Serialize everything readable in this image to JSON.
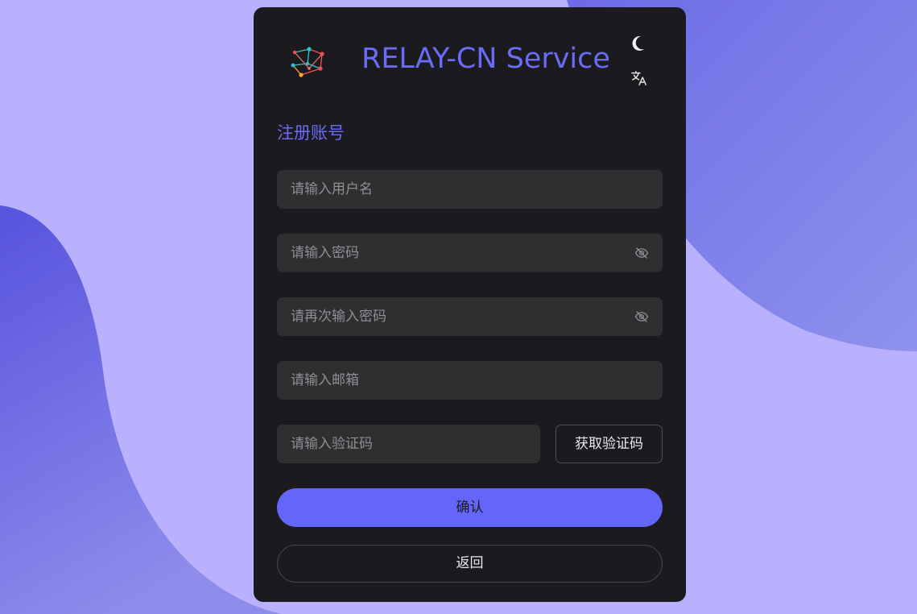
{
  "app": {
    "title": "RELAY-CN Service",
    "logo_icon": "network-graph-logo"
  },
  "header": {
    "theme_toggle_icon": "moon-icon",
    "language_icon": "translate-icon"
  },
  "form": {
    "title": "注册账号",
    "username": {
      "placeholder": "请输入用户名",
      "value": ""
    },
    "password": {
      "placeholder": "请输入密码",
      "value": "",
      "toggle_icon": "eye-off-icon"
    },
    "confirm_password": {
      "placeholder": "请再次输入密码",
      "value": "",
      "toggle_icon": "eye-off-icon"
    },
    "email": {
      "placeholder": "请输入邮箱",
      "value": ""
    },
    "code": {
      "placeholder": "请输入验证码",
      "value": ""
    },
    "get_code_label": "获取验证码",
    "confirm_label": "确认",
    "back_label": "返回"
  },
  "colors": {
    "background": "#b9b1fd",
    "blob": "#6c6be3",
    "card": "#1b1b1f",
    "accent": "#6366f6",
    "input_bg": "#2f2f31"
  }
}
